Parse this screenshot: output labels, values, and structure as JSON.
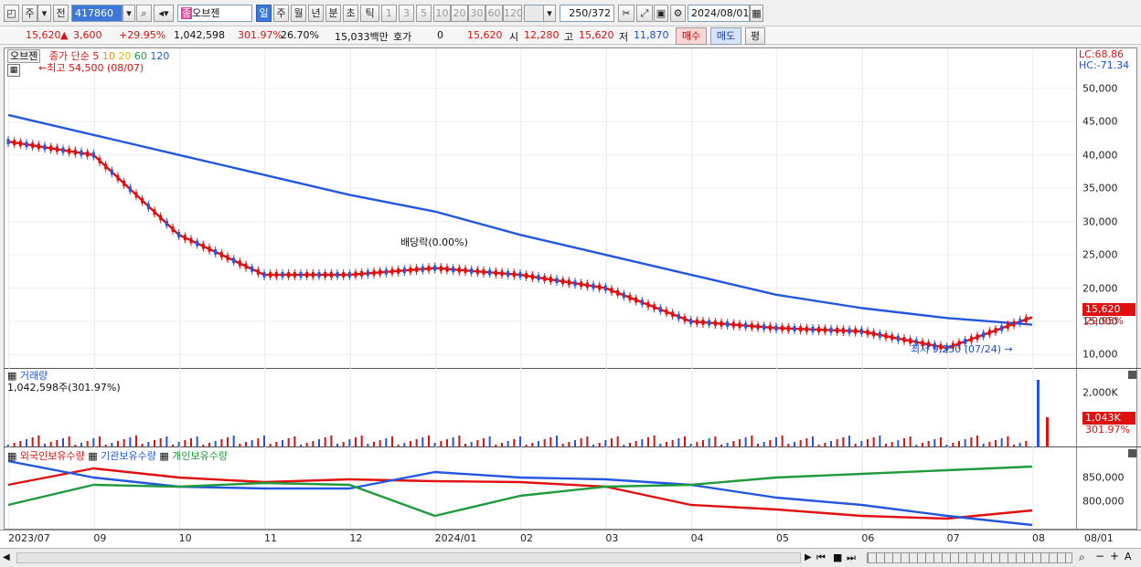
{
  "toolbar": {
    "mode": "주",
    "compare": "전",
    "code": "417860",
    "name": "오브젠",
    "periods": [
      "일",
      "주",
      "월",
      "년",
      "분",
      "초",
      "틱"
    ],
    "counts": [
      "1",
      "3",
      "5",
      "10",
      "20",
      "30",
      "60",
      "120"
    ],
    "range": "250",
    "range_total": "/372",
    "date": "2024/08/01"
  },
  "info": {
    "price": "15,620",
    "change": "3,600",
    "change_pct": "+29.95%",
    "volume": "1,042,598",
    "vol_ratio": "301.97%",
    "turnover": "26.70%",
    "amount": "15,033백만",
    "hoga_label": "호가",
    "hoga_value": "0",
    "ask": "15,620",
    "open_label": "시",
    "open": "12,280",
    "high_label": "고",
    "high": "15,620",
    "low_label": "저",
    "low": "11,870",
    "buy": "매수",
    "sell": "매도",
    "flat": "평"
  },
  "price_panel": {
    "stock": "오브젠",
    "ma_title": "종가 단순",
    "ma_periods": [
      "5",
      "10",
      "20",
      "60",
      "120"
    ],
    "ma_colors": [
      "#e01010",
      "#f08a20",
      "#f5e020",
      "#1f9a3c",
      "#2457e0"
    ],
    "high_note": "←최고 54,500 (08/07)",
    "low_note": "최저 9,250 (07/24) →",
    "div_note": "배당락(0.00%)",
    "lc": "LC:68.86",
    "hc": "HC:-71.34",
    "price_tag": "15,620",
    "pct_tag": "29.95%",
    "ticks": [
      "50,000",
      "45,000",
      "40,000",
      "35,000",
      "30,000",
      "25,000",
      "20,000",
      "15,000",
      "10,000"
    ]
  },
  "volume_panel": {
    "title": "거래량",
    "value": "1,042,598주(301.97%)",
    "ticks": [
      "2,000K",
      "1,000K"
    ],
    "tag": "1,043K",
    "tag_pct": "301.97%"
  },
  "holding_panel": {
    "series": [
      "외국인보유수량",
      "기관보유수량",
      "개인보유수량"
    ],
    "colors": [
      "#e01010",
      "#2457e0",
      "#1f9a3c"
    ],
    "ticks": [
      "850,000",
      "800,000"
    ]
  },
  "x_axis": [
    "2023/07",
    "09",
    "10",
    "11",
    "12",
    "2024/01",
    "02",
    "03",
    "04",
    "05",
    "06",
    "07",
    "08"
  ],
  "x_end": "08/01",
  "chart_data": {
    "type": "line",
    "x": [
      "2023/07",
      "09",
      "10",
      "11",
      "12",
      "2024/01",
      "02",
      "03",
      "04",
      "05",
      "06",
      "07",
      "08"
    ],
    "series": [
      {
        "name": "종가",
        "values": [
          42000,
          40000,
          28000,
          22000,
          22000,
          23000,
          22000,
          20000,
          15000,
          14000,
          13500,
          11000,
          15620
        ]
      },
      {
        "name": "120",
        "values": [
          46000,
          43000,
          40000,
          37000,
          34000,
          31500,
          28000,
          25000,
          22000,
          19000,
          17000,
          15500,
          14500
        ]
      }
    ],
    "ylim": [
      8000,
      56000
    ]
  }
}
